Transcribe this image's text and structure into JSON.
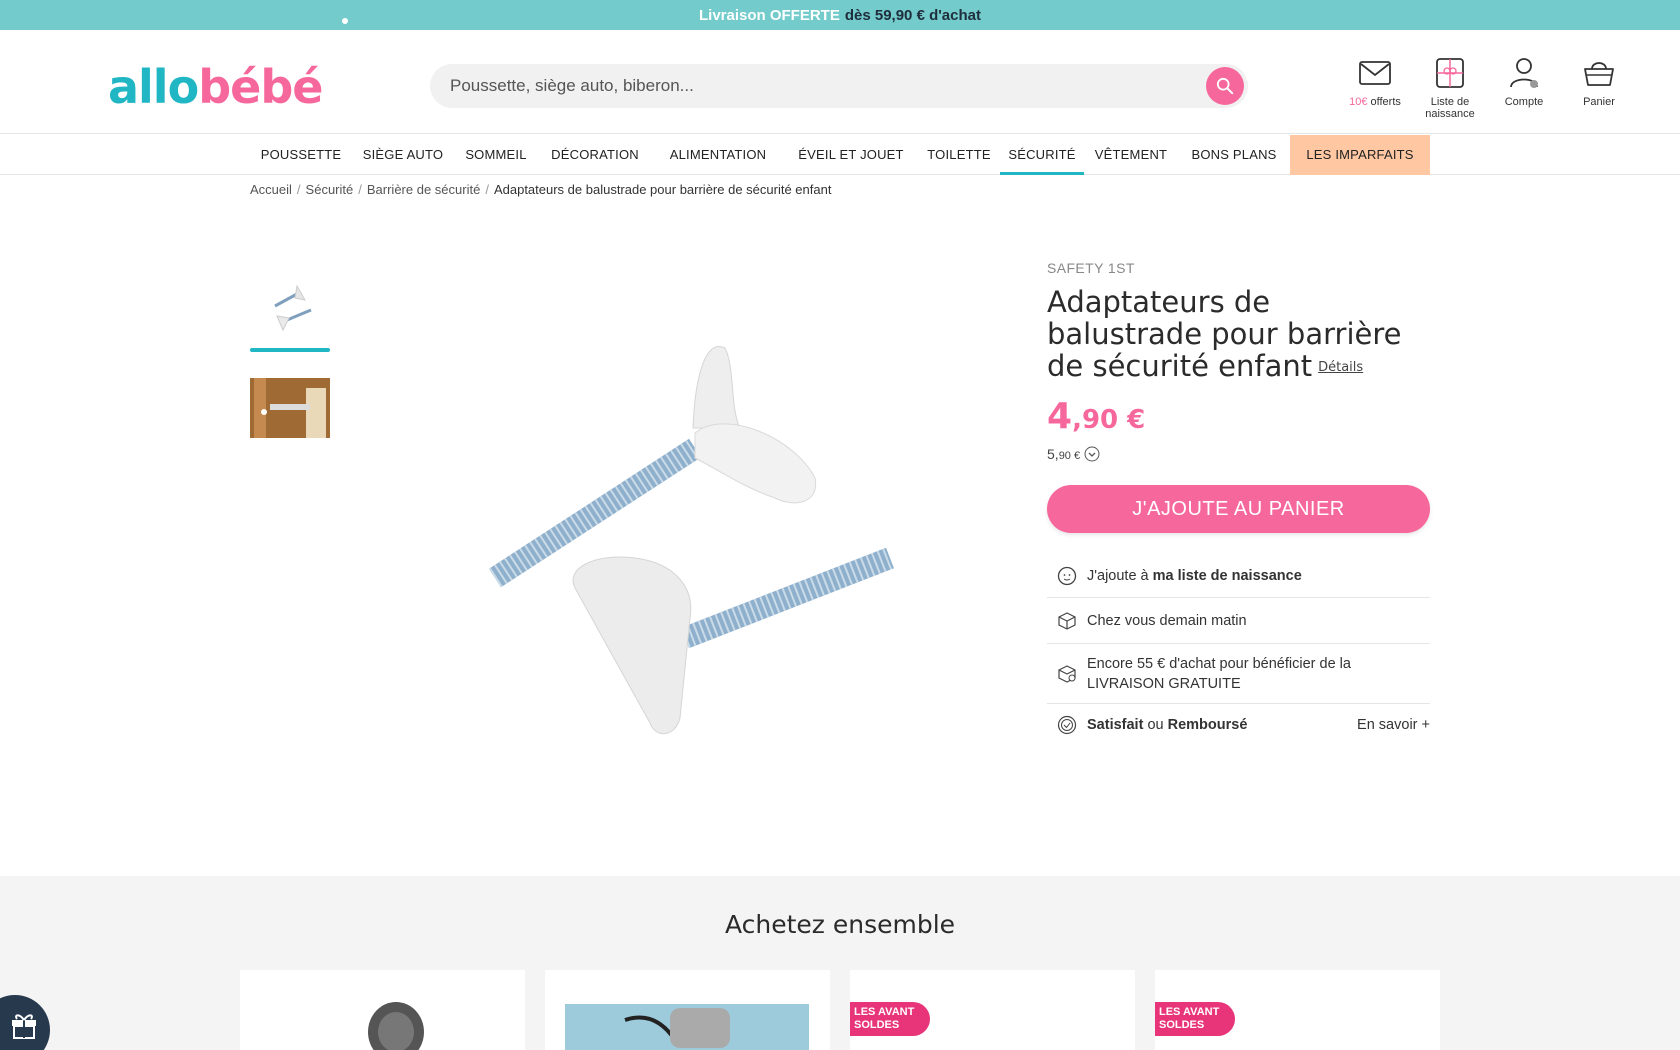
{
  "topbar": {
    "highlight": "Livraison OFFERTE",
    "rest": "dès 59,90 € d'achat"
  },
  "logo": {
    "part1": "allo",
    "part2": "bébé"
  },
  "search": {
    "placeholder": "Poussette, siège auto, biberon..."
  },
  "header_icons": [
    {
      "icon": "envelope-icon",
      "label_pink": "10€",
      "label": "offerts"
    },
    {
      "icon": "gift-list-icon",
      "label": "Liste de naissance"
    },
    {
      "icon": "user-icon",
      "label": "Compte"
    },
    {
      "icon": "basket-icon",
      "label": "Panier"
    }
  ],
  "nav": [
    "POUSSETTE",
    "SIÈGE AUTO",
    "SOMMEIL",
    "DÉCORATION",
    "ALIMENTATION",
    "ÉVEIL ET JOUET",
    "TOILETTE",
    "SÉCURITÉ",
    "VÊTEMENT",
    "BONS PLANS",
    "LES IMPARFAITS"
  ],
  "breadcrumb": [
    "Accueil",
    "Sécurité",
    "Barrière de sécurité",
    "Adaptateurs de balustrade pour barrière de sécurité enfant"
  ],
  "product": {
    "brand": "SAFETY 1ST",
    "title": "Adaptateurs de balustrade pour barrière de sécurité enfant",
    "details_link": "Détails",
    "price_int": "4",
    "price_dec": ",90 €",
    "old_price_int": "5,",
    "old_price_dec": "90 €",
    "add_to_cart": "J'AJOUTE AU PANIER"
  },
  "info_rows": {
    "registry_prefix": "J'ajoute à ",
    "registry_bold": "ma liste de naissance",
    "delivery_prefix": "Chez vous ",
    "delivery_bold": "demain matin",
    "free_shipping": "Encore 55 € d'achat pour bénéficier de la LIVRAISON GRATUITE",
    "satisfied_1": "Satisfait",
    "satisfied_or": " ou ",
    "satisfied_2": "Remboursé",
    "learn_more": "En savoir +"
  },
  "together": {
    "title": "Achetez ensemble",
    "badge": "LES AVANT SOLDES"
  },
  "colors": {
    "pink": "#f6679b",
    "teal": "#20b6c4",
    "topbar": "#73cbcb",
    "peach": "#ffc7a2"
  }
}
